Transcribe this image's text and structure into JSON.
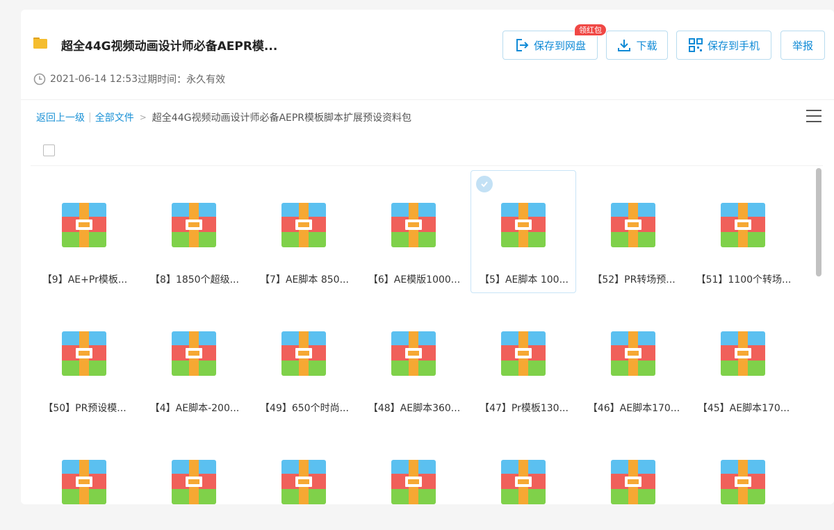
{
  "header": {
    "title": "超全44G视频动画设计师必备AEPR模...",
    "date": "2021-06-14 12:53",
    "expire_label": "过期时间：",
    "expire_value": "永久有效",
    "buttons": {
      "save": "保存到网盘",
      "download": "下载",
      "save_phone": "保存到手机",
      "report": "举报"
    },
    "badge": "领红包"
  },
  "breadcrumb": {
    "back": "返回上一级",
    "all_files": "全部文件",
    "arrow": ">",
    "current": "超全44G视频动画设计师必备AEPR模板脚本扩展预设资料包"
  },
  "files": [
    {
      "name": "【9】AE+Pr模板...",
      "selected": false
    },
    {
      "name": "【8】1850个超级...",
      "selected": false
    },
    {
      "name": "【7】AE脚本 850...",
      "selected": false
    },
    {
      "name": "【6】AE模版1000...",
      "selected": false
    },
    {
      "name": "【5】AE脚本 100...",
      "selected": true
    },
    {
      "name": "【52】PR转场预...",
      "selected": false
    },
    {
      "name": "【51】1100个转场...",
      "selected": false
    },
    {
      "name": "【50】PR预设模...",
      "selected": false
    },
    {
      "name": "【4】AE脚本-200...",
      "selected": false
    },
    {
      "name": "【49】650个时尚...",
      "selected": false
    },
    {
      "name": "【48】AE脚本360...",
      "selected": false
    },
    {
      "name": "【47】Pr模板130...",
      "selected": false
    },
    {
      "name": "【46】AE脚本170...",
      "selected": false
    },
    {
      "name": "【45】AE脚本170...",
      "selected": false
    },
    {
      "name": "",
      "selected": false
    },
    {
      "name": "",
      "selected": false
    },
    {
      "name": "",
      "selected": false
    },
    {
      "name": "",
      "selected": false
    },
    {
      "name": "",
      "selected": false
    },
    {
      "name": "",
      "selected": false
    },
    {
      "name": "",
      "selected": false
    }
  ],
  "colors": {
    "accent": "#0f8ad6",
    "zip_blue": "#5bc0f0",
    "zip_red": "#f0605a",
    "zip_green": "#7fd14a",
    "zip_orange": "#f6a833",
    "badge_red": "#f04845"
  }
}
